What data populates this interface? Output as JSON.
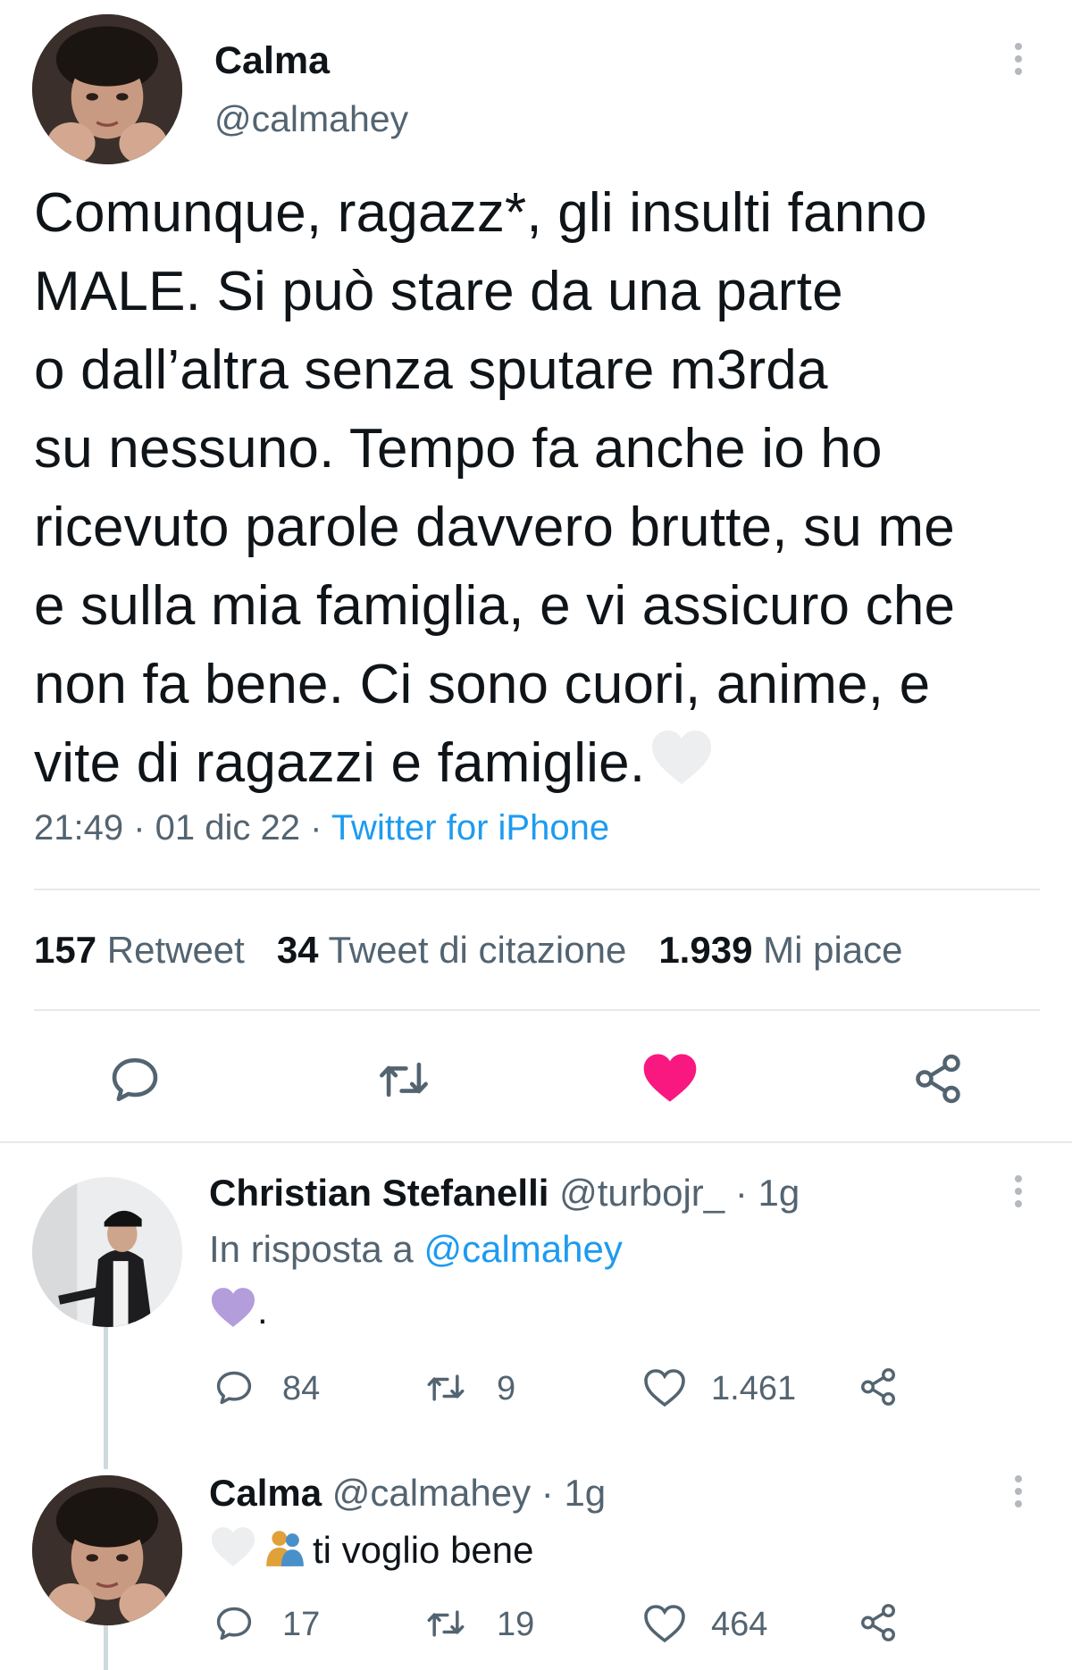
{
  "main_tweet": {
    "author_name": "Calma",
    "author_handle": "@calmahey",
    "text_lines": [
      "Comunque, ragazz*, gli insulti fanno",
      "MALE. Si può stare da una parte",
      "o dall’altra senza sputare m3rda",
      "su nessuno. Tempo fa anche io ho",
      "ricevuto parole davvero brutte, su me",
      "e sulla mia famiglia, e vi assicuro che",
      "non fa bene. Ci sono cuori, anime, e",
      "vite di ragazzi e famiglie."
    ],
    "time": "21:49",
    "date": "01 dic 22",
    "separator": " · ",
    "source": "Twitter for iPhone",
    "stats": {
      "retweets_count": "157",
      "retweets_label": "Retweet",
      "quotes_count": "34",
      "quotes_label": "Tweet di citazione",
      "likes_count": "1.939",
      "likes_label": "Mi piace"
    },
    "liked": true
  },
  "replies": [
    {
      "name": "Christian Stefanelli",
      "handle": "@turbojr_",
      "age": "· 1g",
      "in_reply_prefix": "In risposta a",
      "in_reply_handle": "@calmahey",
      "text": ".",
      "replies": "84",
      "retweets": "9",
      "likes": "1.461"
    },
    {
      "name": "Calma",
      "handle": "@calmahey",
      "age": "· 1g",
      "text": "ti voglio bene",
      "replies": "17",
      "retweets": "19",
      "likes": "464"
    }
  ],
  "colors": {
    "accent": "#1d9bf0",
    "like": "#f91880",
    "muted": "#536471",
    "purple_heart": "#b39ddb"
  },
  "icons": [
    "more-icon",
    "reply-icon",
    "retweet-icon",
    "like-icon",
    "share-icon",
    "white-heart-emoji",
    "purple-heart-emoji",
    "people-hugging-emoji"
  ]
}
